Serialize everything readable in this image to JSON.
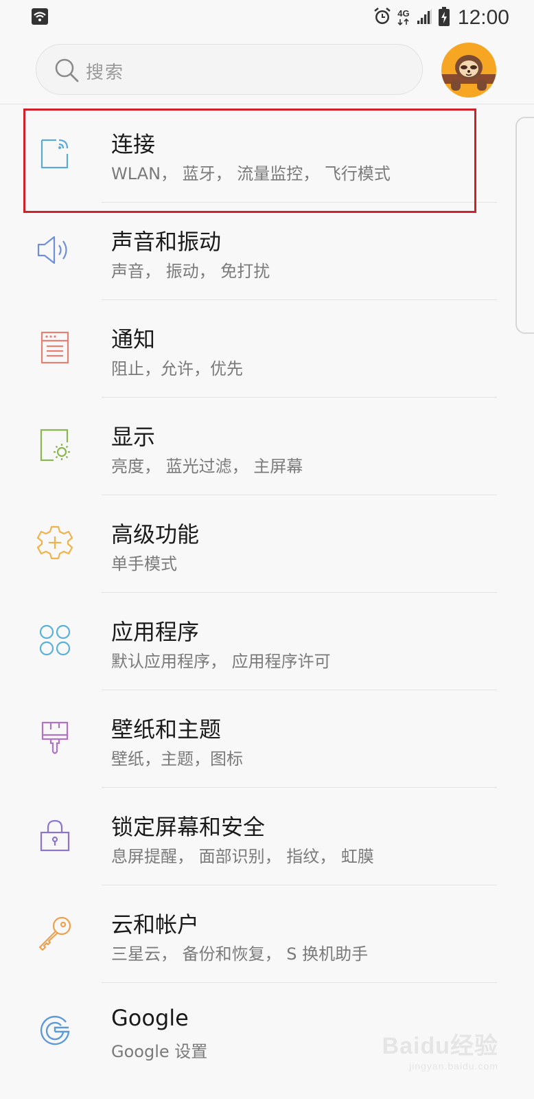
{
  "status_bar": {
    "time": "12:00",
    "network": "4G",
    "icons": [
      "wifi-icon",
      "alarm-icon",
      "signal-icon",
      "battery-icon"
    ]
  },
  "search": {
    "placeholder": "搜索"
  },
  "menu": {
    "items": [
      {
        "title": "连接",
        "subtitle": "WLAN， 蓝牙， 流量监控， 飞行模式",
        "icon": "connection-icon",
        "color": "#5aa9d6"
      },
      {
        "title": "声音和振动",
        "subtitle": "声音， 振动， 免打扰",
        "icon": "speaker-icon",
        "color": "#6d8ed8"
      },
      {
        "title": "通知",
        "subtitle": "阻止，允许，优先",
        "icon": "notification-icon",
        "color": "#e77f72"
      },
      {
        "title": "显示",
        "subtitle": "亮度， 蓝光过滤， 主屏幕",
        "icon": "display-brightness-icon",
        "color": "#8ab650"
      },
      {
        "title": "高级功能",
        "subtitle": "单手模式",
        "icon": "advanced-gear-icon",
        "color": "#f0b24a"
      },
      {
        "title": "应用程序",
        "subtitle": "默认应用程序， 应用程序许可",
        "icon": "apps-icon",
        "color": "#5ab0d8"
      },
      {
        "title": "壁纸和主题",
        "subtitle": "壁纸，主题，图标",
        "icon": "paintbrush-icon",
        "color": "#b072c8"
      },
      {
        "title": "锁定屏幕和安全",
        "subtitle": "息屏提醒， 面部识别， 指纹， 虹膜",
        "icon": "lock-icon",
        "color": "#8a74d0"
      },
      {
        "title": "云和帐户",
        "subtitle": "三星云， 备份和恢复， S 换机助手",
        "icon": "key-icon",
        "color": "#f0a04a"
      },
      {
        "title": "Google",
        "subtitle": "Google 设置",
        "icon": "google-icon",
        "color": "#5b9ad8"
      }
    ]
  },
  "watermark": {
    "main": "Baidu经验",
    "sub": "jingyan.baidu.com"
  },
  "colors": {
    "background": "#f8f8f8",
    "highlight": "#d0202a",
    "avatar": "#f6a623"
  }
}
